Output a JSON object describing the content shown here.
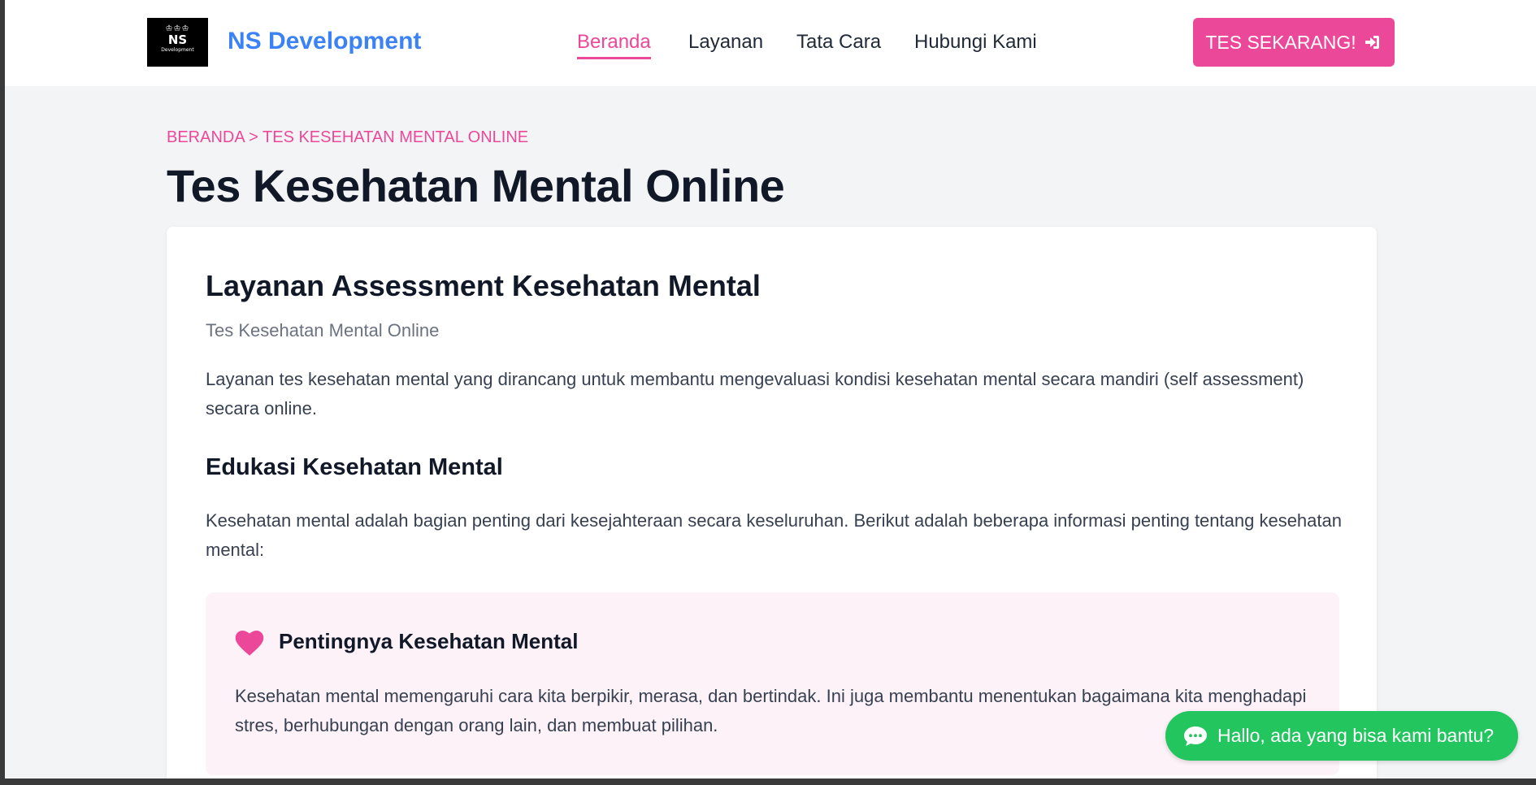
{
  "header": {
    "logo": {
      "mark": "♔♔♔",
      "short": "NS",
      "sub": "Development"
    },
    "brand": "NS Development",
    "nav": [
      {
        "label": "Beranda",
        "active": true
      },
      {
        "label": "Layanan",
        "active": false
      },
      {
        "label": "Tata Cara",
        "active": false
      },
      {
        "label": "Hubungi Kami",
        "active": false
      }
    ],
    "cta_label": "TES SEKARANG!",
    "cta_icon": "sign-in-icon"
  },
  "breadcrumb": "BERANDA > TES KESEHATAN MENTAL ONLINE",
  "page_title": "Tes Kesehatan Mental Online",
  "card": {
    "title": "Layanan Assessment Kesehatan Mental",
    "subtitle": "Tes Kesehatan Mental Online",
    "description": "Layanan tes kesehatan mental yang dirancang untuk membantu mengevaluasi kondisi kesehatan mental secara mandiri (self assessment) secara online.",
    "section_title": "Edukasi Kesehatan Mental",
    "section_description": "Kesehatan mental adalah bagian penting dari kesejahteraan secara keseluruhan. Berikut adalah beberapa informasi penting tentang kesehatan mental:",
    "info_box": {
      "icon": "heart-icon",
      "title": "Pentingnya Kesehatan Mental",
      "text": "Kesehatan mental memengaruhi cara kita berpikir, merasa, dan bertindak. Ini juga membantu menentukan bagaimana kita menghadapi stres, berhubungan dengan orang lain, dan membuat pilihan."
    }
  },
  "chat_widget": {
    "label": "Hallo, ada yang bisa kami bantu?",
    "icon": "chat-bubble-icon"
  },
  "colors": {
    "accent": "#ec4899",
    "brand": "#3b82f6",
    "chat": "#22c55e",
    "info_bg": "#fdf2f8",
    "page_bg": "#f3f4f6"
  }
}
